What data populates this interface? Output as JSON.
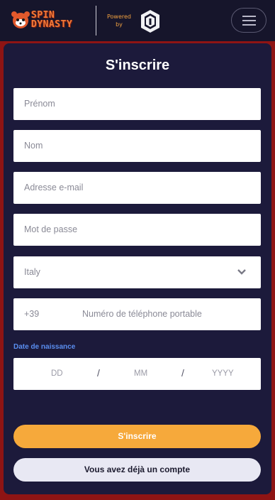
{
  "header": {
    "logo_line1": "SPIN",
    "logo_line2": "DYNASTY",
    "powered_line1": "Powered",
    "powered_line2": "by",
    "menu_icon": "hamburger-menu-icon",
    "powered_icon": "shield-logo-icon"
  },
  "form": {
    "title": "S'inscrire",
    "first_name_placeholder": "Prénom",
    "last_name_placeholder": "Nom",
    "email_placeholder": "Adresse e-mail",
    "password_placeholder": "Mot de passe",
    "country_value": "Italy",
    "phone_dial_code": "+39",
    "phone_placeholder": "Numéro de téléphone portable",
    "dob_label": "Date de naissance",
    "dob_day_placeholder": "DD",
    "dob_month_placeholder": "MM",
    "dob_year_placeholder": "YYYY",
    "dob_separator": "/",
    "submit_label": "S'inscrire",
    "login_label": "Vous avez déjà un compte"
  },
  "colors": {
    "background_frame": "#8e1414",
    "header_bg": "#16152b",
    "panel_bg": "#1c1a3b",
    "accent_orange": "#f6a93b",
    "dob_label_blue": "#5a8ef0"
  }
}
